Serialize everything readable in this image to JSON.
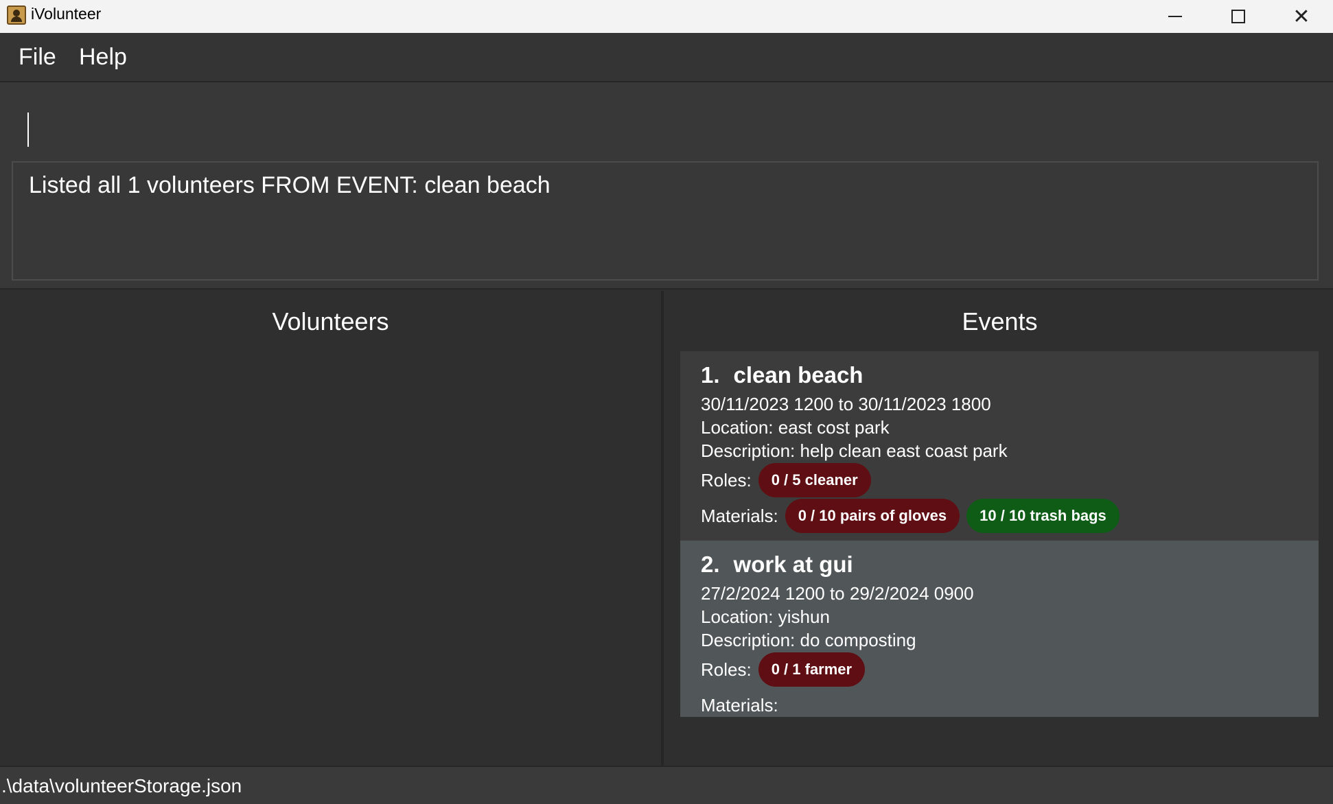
{
  "window": {
    "title": "iVolunteer",
    "icon": "app-icon",
    "controls": {
      "minimize": "minimize-icon",
      "maximize": "maximize-icon",
      "close": "✕"
    }
  },
  "menu": {
    "file": "File",
    "help": "Help"
  },
  "command": {
    "value": "",
    "placeholder": ""
  },
  "result": {
    "text": "Listed all 1 volunteers FROM EVENT: clean beach"
  },
  "volunteers": {
    "title": "Volunteers",
    "items": []
  },
  "events": {
    "title": "Events",
    "items": [
      {
        "index": "1.",
        "name": "clean beach",
        "datetime": "30/11/2023 1200 to 30/11/2023 1800",
        "location": "Location: east cost park",
        "description": "Description: help clean east coast park",
        "roles_label": "Roles:",
        "roles": [
          {
            "text": "0 / 5 cleaner",
            "color": "#5f0e13"
          }
        ],
        "materials_label": "Materials:",
        "materials": [
          {
            "text": "0 / 10 pairs of gloves",
            "color": "#5f0e13"
          },
          {
            "text": "10 / 10 trash bags",
            "color": "#0f5c17"
          }
        ]
      },
      {
        "index": "2.",
        "name": "work at gui",
        "datetime": "27/2/2024 1200 to 29/2/2024 0900",
        "location": "Location: yishun",
        "description": "Description: do composting",
        "roles_label": "Roles:",
        "roles": [
          {
            "text": "0 / 1 farmer",
            "color": "#5f0e13"
          }
        ],
        "materials_label": "Materials:",
        "materials": []
      }
    ]
  },
  "status": {
    "path": ".\\data\\volunteerStorage.json"
  }
}
